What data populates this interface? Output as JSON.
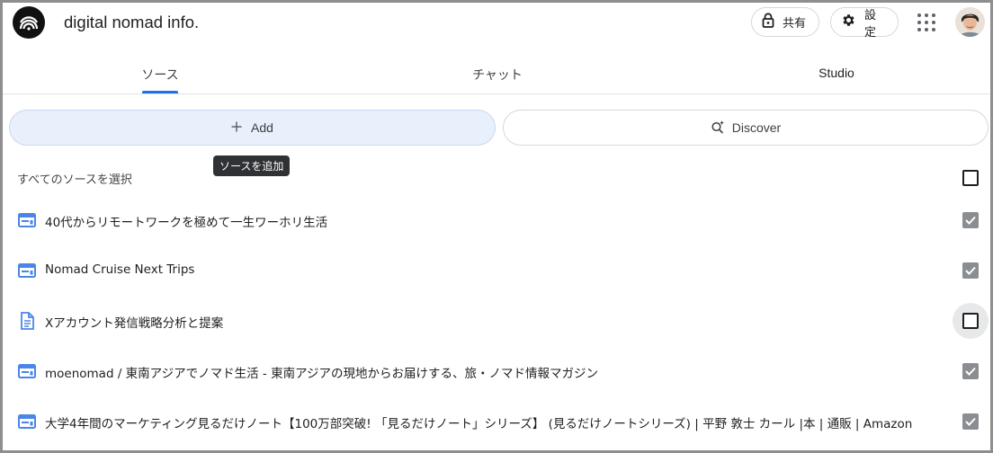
{
  "header": {
    "notebook_title": "digital nomad info.",
    "share_label": "共有",
    "settings_label": "設定"
  },
  "tabs": [
    {
      "label": "ソース",
      "active": true
    },
    {
      "label": "チャット",
      "active": false
    },
    {
      "label": "Studio",
      "active": false
    }
  ],
  "actions": {
    "add_label": "Add",
    "discover_label": "Discover",
    "add_tooltip": "ソースを追加"
  },
  "sources": {
    "select_all_label": "すべてのソースを選択",
    "select_all_checked": false,
    "items": [
      {
        "title": "40代からリモートワークを極めて一生ワーホリ生活",
        "icon": "web-source-icon",
        "checked": true
      },
      {
        "title": "Nomad Cruise Next Trips",
        "icon": "web-source-icon",
        "checked": true
      },
      {
        "title": "Xアカウント発信戦略分析と提案",
        "icon": "document-source-icon",
        "checked": false
      },
      {
        "title": "moenomad / 東南アジアでノマド生活 - 東南アジアの現地からお届けする、旅・ノマド情報マガジン",
        "icon": "web-source-icon",
        "checked": true
      },
      {
        "title": "大学4年間のマーケティング見るだけノート【100万部突破! 「見るだけノート」シリーズ】 (見るだけノートシリーズ) | 平野 敦士 カール |本 | 通販 | Amazon",
        "icon": "web-source-icon",
        "checked": true
      }
    ]
  },
  "colors": {
    "accent": "#1a73e8",
    "add_button_bg": "#e8f0fb",
    "source_icon": "#4a86e8",
    "checked_box": "#8a8d91"
  }
}
